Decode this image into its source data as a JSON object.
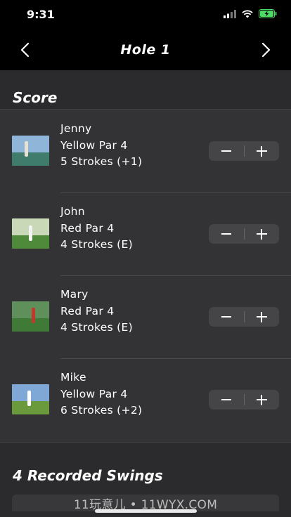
{
  "status_bar": {
    "time": "9:31"
  },
  "nav": {
    "title": "Hole 1"
  },
  "sections": {
    "score": "Score",
    "swings": "4 Recorded Swings"
  },
  "players": [
    {
      "name": "Jenny",
      "tee": "Yellow Par 4",
      "strokes": "5 Strokes (+1)"
    },
    {
      "name": "John",
      "tee": "Red Par 4",
      "strokes": "4 Strokes (E)"
    },
    {
      "name": "Mary",
      "tee": "Red Par 4",
      "strokes": "4 Strokes (E)"
    },
    {
      "name": "Mike",
      "tee": "Yellow Par 4",
      "strokes": "6 Strokes (+2)"
    }
  ],
  "watermark": "11玩意儿 • 11WYX.COM",
  "colors": {
    "background": "#2b2b2d",
    "bar": "#000000",
    "stepper": "#454547",
    "battery": "#4cd964"
  }
}
